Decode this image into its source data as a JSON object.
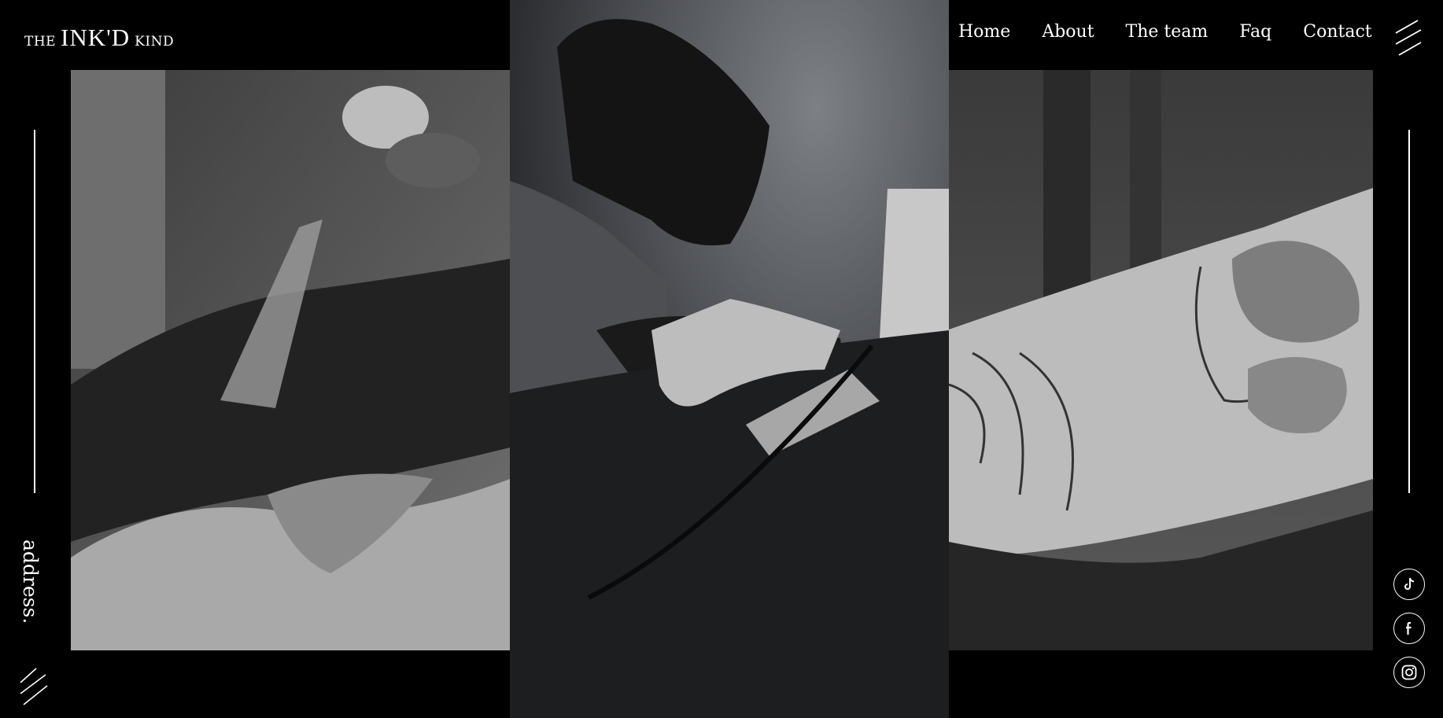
{
  "logo": {
    "prefix": "THE",
    "brand": "INK'D",
    "suffix": "KIND"
  },
  "nav": {
    "items": [
      {
        "label": "Home"
      },
      {
        "label": "About"
      },
      {
        "label": "The team"
      },
      {
        "label": "Faq"
      },
      {
        "label": "Contact"
      }
    ]
  },
  "sidebar": {
    "address_label": "address."
  },
  "photos": {
    "left": "tattoo-machine-closeup-photo",
    "center": "tattoo-artist-working-photo",
    "right": "tattooed-forearm-photo"
  },
  "socials": [
    {
      "icon": "tiktok-icon"
    },
    {
      "icon": "facebook-icon"
    },
    {
      "icon": "instagram-icon"
    }
  ],
  "colors": {
    "background": "#000000",
    "text": "#ffffff"
  }
}
